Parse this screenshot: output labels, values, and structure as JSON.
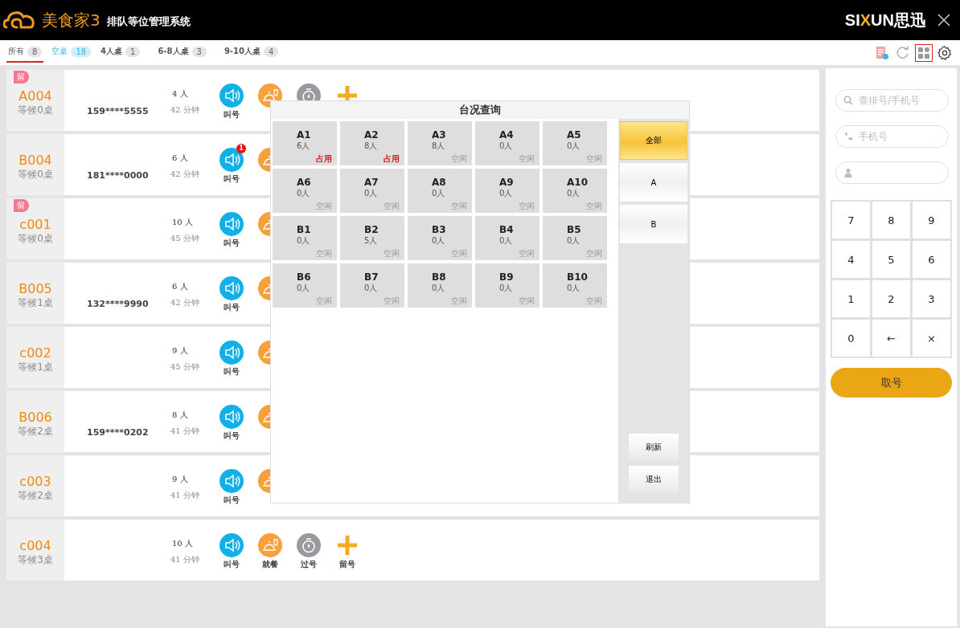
{
  "header": {
    "product": "美食家3",
    "title": "排队等位管理系统",
    "brand": {
      "lead": "SI",
      "accent": "X",
      "tail": "UN思迅"
    }
  },
  "tabs": [
    {
      "label": "所有",
      "count": "8",
      "kind": "all",
      "selected": true
    },
    {
      "label": "空桌",
      "count": "18",
      "kind": "free",
      "selected": false
    },
    {
      "label": "4人桌",
      "count": "1",
      "kind": "size",
      "selected": false
    },
    {
      "label": "6-8人桌",
      "count": "3",
      "kind": "size",
      "selected": false
    },
    {
      "label": "9-10人桌",
      "count": "4",
      "kind": "size",
      "selected": false
    }
  ],
  "toolbar": [
    {
      "kind": "report",
      "selected": false
    },
    {
      "kind": "refresh",
      "selected": false
    },
    {
      "kind": "grid",
      "selected": true
    },
    {
      "kind": "settings",
      "selected": false
    }
  ],
  "queue": [
    {
      "number": "A004",
      "waiting": "等候0桌",
      "tag": "留",
      "phone": "159****5555",
      "party": "4 人",
      "wait_time": "42 分钟",
      "actions": [
        {
          "kind": "call",
          "label": "叫号"
        },
        {
          "kind": "dine"
        },
        {
          "kind": "skip"
        },
        {
          "kind": "hold"
        }
      ]
    },
    {
      "number": "B004",
      "waiting": "等候0桌",
      "phone": "181****0000",
      "party": "6 人",
      "wait_time": "42 分钟",
      "actions": [
        {
          "kind": "call",
          "label": "叫号",
          "badge": "1"
        },
        {
          "kind": "dine"
        }
      ]
    },
    {
      "number": "c001",
      "waiting": "等候0桌",
      "tag": "留",
      "party": "10 人",
      "wait_time": "45 分钟",
      "actions": [
        {
          "kind": "call",
          "label": "叫号"
        },
        {
          "kind": "dine"
        }
      ]
    },
    {
      "number": "B005",
      "waiting": "等候1桌",
      "phone": "132****9990",
      "party": "6 人",
      "wait_time": "42 分钟",
      "actions": [
        {
          "kind": "call",
          "label": "叫号"
        },
        {
          "kind": "dine"
        }
      ]
    },
    {
      "number": "c002",
      "waiting": "等候1桌",
      "party": "9 人",
      "wait_time": "45 分钟",
      "actions": [
        {
          "kind": "call",
          "label": "叫号"
        },
        {
          "kind": "dine"
        }
      ]
    },
    {
      "number": "B006",
      "waiting": "等候2桌",
      "phone": "159****0202",
      "party": "8 人",
      "wait_time": "41 分钟",
      "actions": [
        {
          "kind": "call",
          "label": "叫号"
        },
        {
          "kind": "dine"
        }
      ]
    },
    {
      "number": "c003",
      "waiting": "等候2桌",
      "party": "9 人",
      "wait_time": "41 分钟",
      "actions": [
        {
          "kind": "call",
          "label": "叫号"
        },
        {
          "kind": "dine"
        }
      ]
    },
    {
      "number": "c004",
      "waiting": "等候3桌",
      "party": "10 人",
      "wait_time": "41 分钟",
      "actions": [
        {
          "kind": "call",
          "label": "叫号"
        },
        {
          "kind": "dine",
          "label": "就餐"
        },
        {
          "kind": "skip",
          "label": "过号"
        },
        {
          "kind": "hold",
          "label": "留号"
        }
      ]
    }
  ],
  "table_status_dialog": {
    "title": "台况查询",
    "tables": [
      {
        "name": "A1",
        "guests": "6人",
        "status": "占用",
        "occupied": true
      },
      {
        "name": "A2",
        "guests": "8人",
        "status": "占用",
        "occupied": true
      },
      {
        "name": "A3",
        "guests": "8人",
        "status": "空闲",
        "occupied": false
      },
      {
        "name": "A4",
        "guests": "0人",
        "status": "空闲",
        "occupied": false
      },
      {
        "name": "A5",
        "guests": "0人",
        "status": "空闲",
        "occupied": false
      },
      {
        "name": "A6",
        "guests": "0人",
        "status": "空闲",
        "occupied": false
      },
      {
        "name": "A7",
        "guests": "0人",
        "status": "空闲",
        "occupied": false
      },
      {
        "name": "A8",
        "guests": "0人",
        "status": "空闲",
        "occupied": false
      },
      {
        "name": "A9",
        "guests": "0人",
        "status": "空闲",
        "occupied": false
      },
      {
        "name": "A10",
        "guests": "0人",
        "status": "空闲",
        "occupied": false
      },
      {
        "name": "B1",
        "guests": "0人",
        "status": "空闲",
        "occupied": false
      },
      {
        "name": "B2",
        "guests": "5人",
        "status": "空闲",
        "occupied": false
      },
      {
        "name": "B3",
        "guests": "0人",
        "status": "空闲",
        "occupied": false
      },
      {
        "name": "B4",
        "guests": "0人",
        "status": "空闲",
        "occupied": false
      },
      {
        "name": "B5",
        "guests": "0人",
        "status": "空闲",
        "occupied": false
      },
      {
        "name": "B6",
        "guests": "0人",
        "status": "空闲",
        "occupied": false
      },
      {
        "name": "B7",
        "guests": "0人",
        "status": "空闲",
        "occupied": false
      },
      {
        "name": "B8",
        "guests": "0人",
        "status": "空闲",
        "occupied": false
      },
      {
        "name": "B9",
        "guests": "0人",
        "status": "空闲",
        "occupied": false
      },
      {
        "name": "B10",
        "guests": "0人",
        "status": "空闲",
        "occupied": false
      }
    ],
    "areas": [
      {
        "label": "全部",
        "selected": true
      },
      {
        "label": "A",
        "selected": false
      },
      {
        "label": "B",
        "selected": false
      }
    ],
    "buttons": [
      "刷新",
      "退出"
    ]
  },
  "side_panel": {
    "search": {
      "placeholder": "查排号/手机号"
    },
    "phone": {
      "placeholder": "手机号"
    },
    "keypad": [
      "7",
      "8",
      "9",
      "4",
      "5",
      "6",
      "1",
      "2",
      "3",
      "0",
      "←",
      "×"
    ],
    "take_number": "取号"
  }
}
